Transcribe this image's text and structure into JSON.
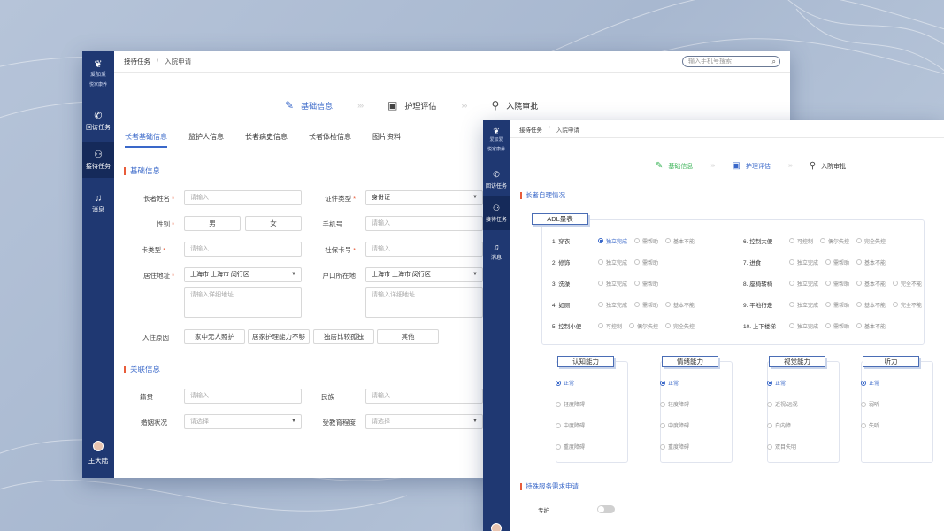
{
  "app": {
    "logo_text": "爱加爱",
    "logo_sub": "悦家康养"
  },
  "sidebar": {
    "items": [
      {
        "label": "回访任务",
        "icon": "phone-icon"
      },
      {
        "label": "接待任务",
        "icon": "people-icon"
      },
      {
        "label": "消息",
        "icon": "bell-icon"
      }
    ],
    "user": "王大陆"
  },
  "w1": {
    "breadcrumb": [
      "接待任务",
      "入院申请"
    ],
    "search_placeholder": "输入手机号搜索",
    "steps": [
      "基础信息",
      "护理评估",
      "入院审批"
    ],
    "tabs": [
      "长者基础信息",
      "监护人信息",
      "长者病史信息",
      "长者体检信息",
      "图片资料"
    ],
    "section_basic": "基础信息",
    "fields": {
      "name_label": "长者姓名",
      "name_ph": "请输入",
      "idtype_label": "证件类型",
      "idtype_val": "身份证",
      "gender_label": "性别",
      "male": "男",
      "female": "女",
      "phone_label": "手机号",
      "phone_ph": "请输入",
      "card_label": "卡类型",
      "card_ph": "请输入",
      "social_label": "社保卡号",
      "social_ph": "请输入",
      "addr_label": "居住地址",
      "addr_val": "上海市 上海市 闵行区",
      "addr_detail_ph": "请输入详细地址",
      "hukou_label": "户口所在地",
      "hukou_val": "上海市 上海市 闵行区",
      "hukou_detail_ph": "请输入详细地址",
      "reason_label": "入住原因",
      "reasons": [
        "家中无人照护",
        "居家护理能力不够",
        "独居比较孤独",
        "其他"
      ]
    },
    "section_related": "关联信息",
    "related": {
      "native_label": "籍贯",
      "native_ph": "请输入",
      "ethnic_label": "民族",
      "ethnic_ph": "请输入",
      "marital_label": "婚姻状况",
      "marital_ph": "请选择",
      "edu_label": "受教育程度",
      "edu_ph": "请选择"
    }
  },
  "w2": {
    "breadcrumb": [
      "接待任务",
      "入院申请"
    ],
    "steps": [
      "基础信息",
      "护理评估",
      "入院审批"
    ],
    "section": "长者自理情况",
    "adl_title": "ADL量表",
    "adl_left": [
      {
        "label": "1. 穿衣",
        "opts": [
          "独立完成",
          "需帮助",
          "基本不能"
        ],
        "sel": 0
      },
      {
        "label": "2. 修饰",
        "opts": [
          "独立完成",
          "需帮助"
        ],
        "sel": -1
      },
      {
        "label": "3. 洗澡",
        "opts": [
          "独立完成",
          "需帮助"
        ],
        "sel": -1
      },
      {
        "label": "4. 如厕",
        "opts": [
          "独立完成",
          "需帮助",
          "基本不能"
        ],
        "sel": -1
      },
      {
        "label": "5. 控制小便",
        "opts": [
          "可控制",
          "偶尔失控",
          "完全失控"
        ],
        "sel": -1
      }
    ],
    "adl_right": [
      {
        "label": "6. 控制大便",
        "opts": [
          "可控制",
          "偶尔失控",
          "完全失控"
        ],
        "sel": -1
      },
      {
        "label": "7. 进食",
        "opts": [
          "独立完成",
          "需帮助",
          "基本不能"
        ],
        "sel": -1
      },
      {
        "label": "8. 座椅转椅",
        "opts": [
          "独立完成",
          "需帮助",
          "基本不能",
          "完全不能"
        ],
        "sel": -1
      },
      {
        "label": "9. 平地行走",
        "opts": [
          "独立完成",
          "需帮助",
          "基本不能",
          "完全不能"
        ],
        "sel": -1
      },
      {
        "label": "10. 上下楼梯",
        "opts": [
          "独立完成",
          "需帮助",
          "基本不能"
        ],
        "sel": -1
      }
    ],
    "abilities": [
      {
        "title": "认知能力",
        "opts": [
          "正常",
          "轻度障碍",
          "中度障碍",
          "重度障碍"
        ]
      },
      {
        "title": "情绪能力",
        "opts": [
          "正常",
          "轻度障碍",
          "中度障碍",
          "重度障碍"
        ]
      },
      {
        "title": "视觉能力",
        "opts": [
          "正常",
          "近视/远视",
          "白内障",
          "双目失明"
        ]
      },
      {
        "title": "听力",
        "opts": [
          "正常",
          "弱听",
          "失听"
        ]
      }
    ],
    "special_section": "特殊服务需求申请",
    "special_label": "专护",
    "special_on": false
  },
  "colors": {
    "sidebar": "#1f3872",
    "accent": "#3a68c9",
    "required": "#e85c3a",
    "step2_active": "#3db55a"
  }
}
